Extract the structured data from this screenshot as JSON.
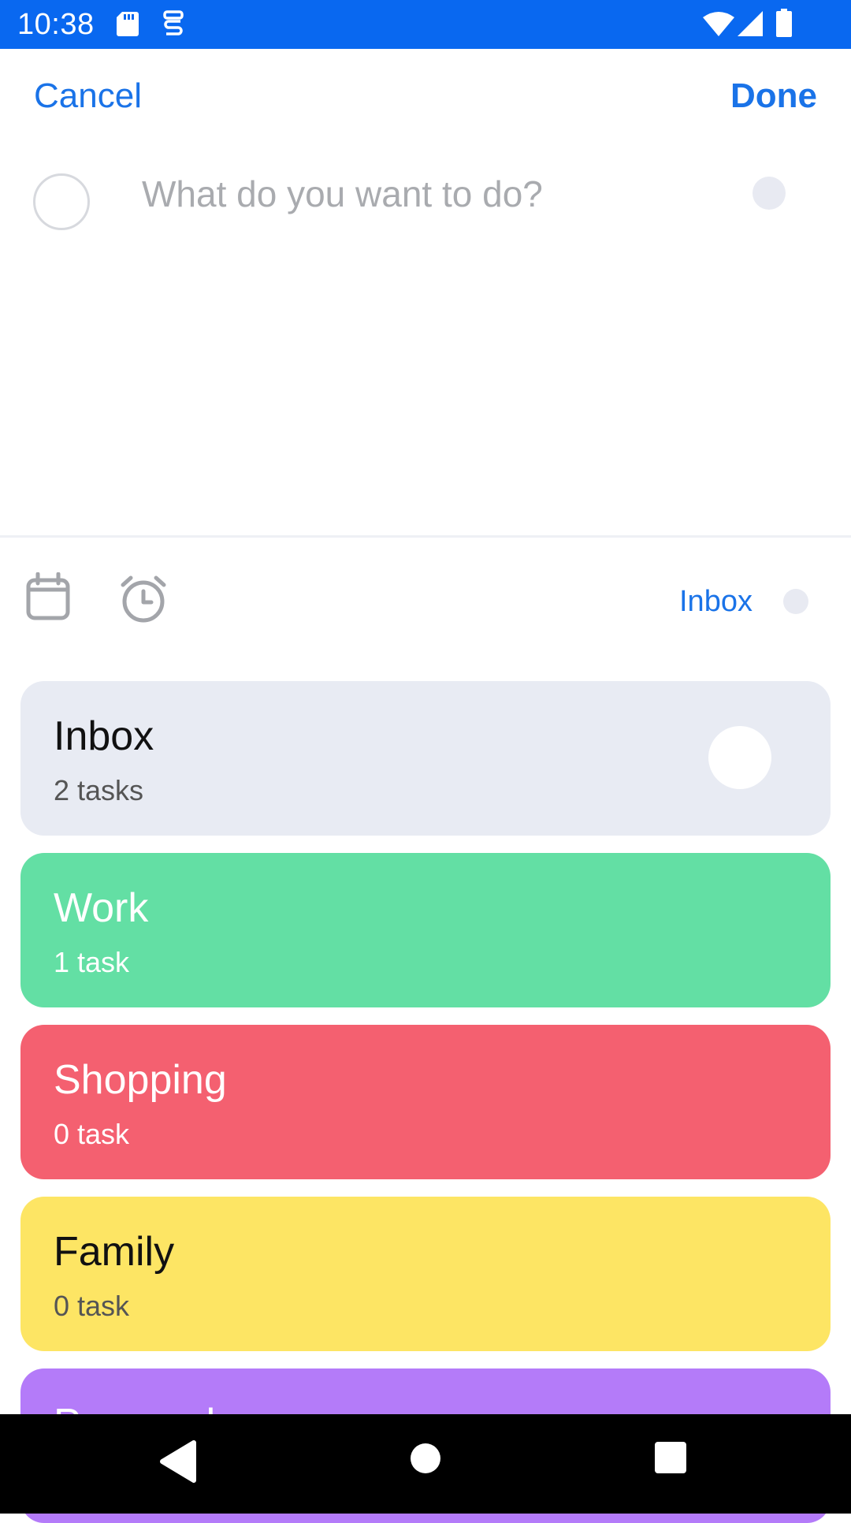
{
  "status_bar": {
    "time": "10:38",
    "left_icons": [
      "sd-card-icon",
      "vpn-key-icon"
    ],
    "right_icons": [
      "wifi-icon",
      "cell-signal-icon",
      "battery-icon"
    ],
    "background": "#0968F0"
  },
  "header": {
    "cancel_label": "Cancel",
    "done_label": "Done"
  },
  "task_input": {
    "value": "",
    "placeholder": "What do you want to do?"
  },
  "toolbar": {
    "icons": [
      "calendar-icon",
      "alarm-icon"
    ],
    "project_label": "Inbox"
  },
  "projects": [
    {
      "title": "Inbox",
      "count": "2 tasks",
      "color": "#E8EBF3",
      "title_color": "#111111",
      "count_color": "#555555",
      "selected": true
    },
    {
      "title": "Work",
      "count": "1 task",
      "color": "#63DFA4",
      "title_color": "#FFFFFF",
      "count_color": "#FFFFFF",
      "selected": false
    },
    {
      "title": "Shopping",
      "count": "0 task",
      "color": "#F46070",
      "title_color": "#FFFFFF",
      "count_color": "#FFFFFF",
      "selected": false
    },
    {
      "title": "Family",
      "count": "0 task",
      "color": "#FDE564",
      "title_color": "#111111",
      "count_color": "#555555",
      "selected": false
    },
    {
      "title": "Personal",
      "count": "",
      "color": "#B47BF9",
      "title_color": "#FFFFFF",
      "count_color": "#FFFFFF",
      "selected": false
    }
  ],
  "nav_bar": {
    "buttons": [
      "back-icon",
      "home-icon",
      "recents-icon"
    ]
  }
}
